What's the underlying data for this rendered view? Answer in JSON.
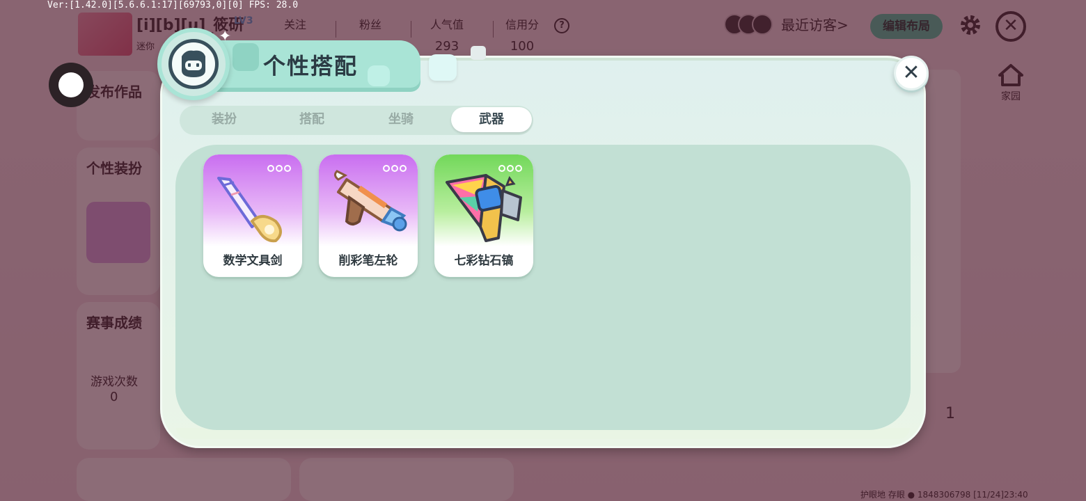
{
  "debug": {
    "version_text": "Ver:[1.42.0][5.6.6.1:17][69793,0][0] FPS: 28.0"
  },
  "background": {
    "player_name": "[i][b][u]_筱研",
    "level": "LV3",
    "sub_label": "迷你",
    "stats": [
      {
        "label": "关注",
        "value": ""
      },
      {
        "label": "粉丝",
        "value": ""
      },
      {
        "label": "人气值",
        "value": "293"
      },
      {
        "label": "信用分",
        "value": "100"
      }
    ],
    "recent_visitors": "最近访客>",
    "edit_layout": "编辑布局",
    "home": "家园",
    "cards": [
      {
        "title": "发布作品"
      },
      {
        "title": "个性装扮"
      },
      {
        "title": "赛事成绩"
      }
    ],
    "game_count_label": "游戏次数",
    "game_count_value": "0",
    "right_value": "1",
    "bottom_info": "护眼地 存眼 ●   1848306798   [11/24]23:40"
  },
  "modal": {
    "title": "个性搭配",
    "close_label": "✕",
    "tabs": [
      {
        "label": "装扮",
        "active": false
      },
      {
        "label": "搭配",
        "active": false
      },
      {
        "label": "坐骑",
        "active": false
      },
      {
        "label": "武器",
        "active": true
      }
    ],
    "items": [
      {
        "name": "数学文具剑",
        "rarity_color": "#c96ef0",
        "icon": "ruler-sword-icon"
      },
      {
        "name": "削彩笔左轮",
        "rarity_color": "#c96ef0",
        "icon": "pencil-revolver-icon"
      },
      {
        "name": "七彩钻石镐",
        "rarity_color": "#72d85a",
        "icon": "rainbow-diamond-pickaxe-icon"
      }
    ]
  }
}
